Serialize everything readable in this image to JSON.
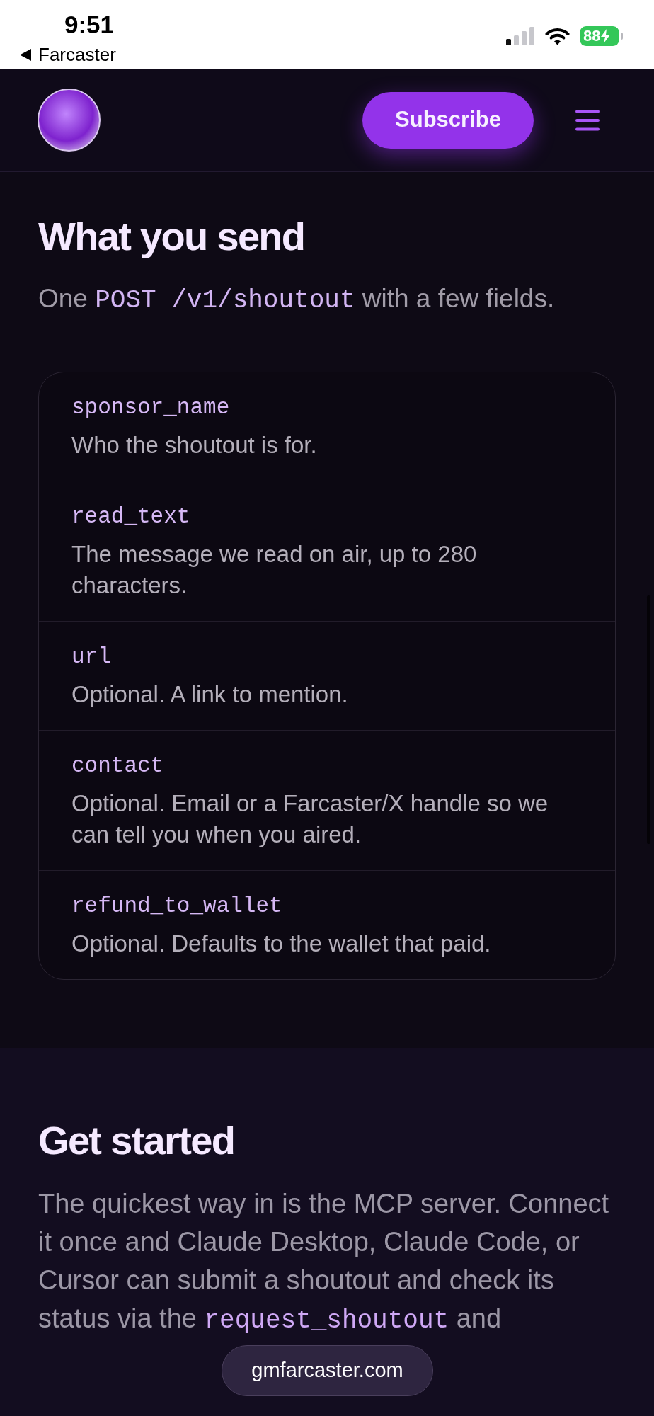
{
  "status_bar": {
    "time": "9:51",
    "back_label": "Farcaster",
    "battery": "88"
  },
  "header": {
    "subscribe_button": "Subscribe"
  },
  "send_section": {
    "title": "What you send",
    "subtitle": [
      {
        "kind": "text",
        "text": "One "
      },
      {
        "kind": "code",
        "text": "POST /v1/shoutout"
      },
      {
        "kind": "text",
        "text": " with a few fields."
      }
    ],
    "fields": [
      {
        "name": "sponsor_name",
        "description": "Who the shoutout is for."
      },
      {
        "name": "read_text",
        "description": "The message we read on air, up to 280 characters."
      },
      {
        "name": "url",
        "description": "Optional. A link to mention."
      },
      {
        "name": "contact",
        "description": "Optional. Email or a Farcaster/X handle so we can tell you when you aired."
      },
      {
        "name": "refund_to_wallet",
        "description": "Optional. Defaults to the wallet that paid."
      }
    ]
  },
  "start_section": {
    "title": "Get started",
    "paragraph": [
      {
        "kind": "text",
        "text": "The quickest way in is the MCP server. Connect it once and Claude Desktop, Claude Code, or Cursor can submit a shoutout and check its status via the "
      },
      {
        "kind": "code",
        "text": "request_shoutout"
      },
      {
        "kind": "text",
        "text": " and"
      }
    ]
  },
  "address_bar": {
    "url": "gmfarcaster.com"
  }
}
